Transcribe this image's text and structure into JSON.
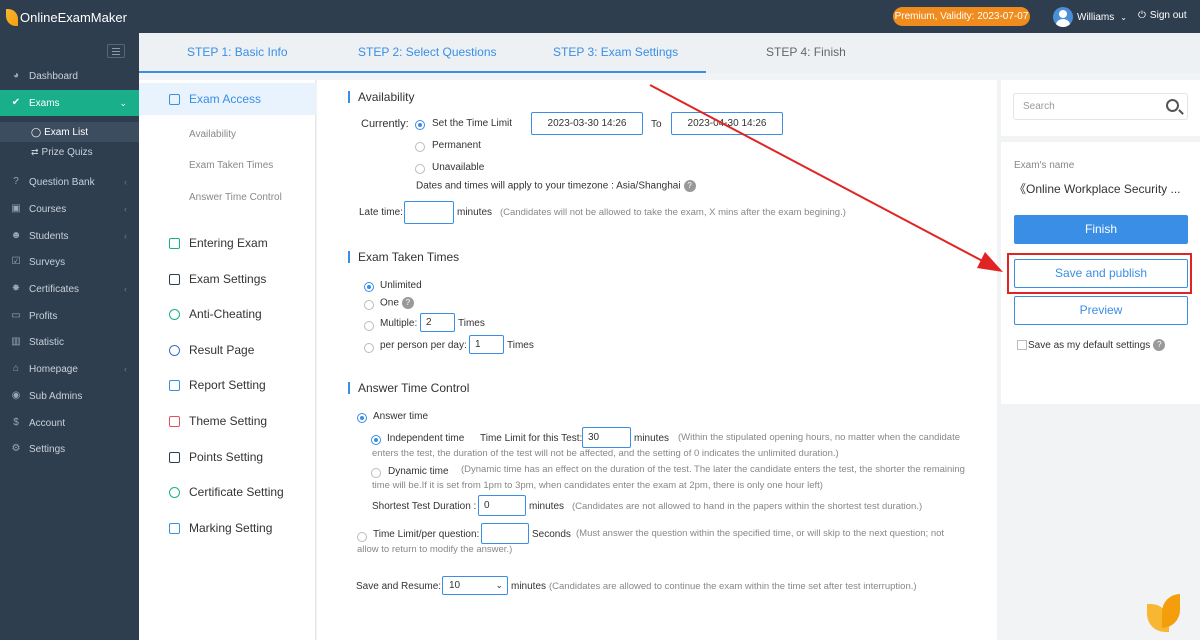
{
  "app": {
    "name": "OnlineExamMaker"
  },
  "header": {
    "premium": "Premium, Validity: 2023-07-07",
    "user": "Williams",
    "signout": "Sign out"
  },
  "sidebar": {
    "items": [
      {
        "label": "Dashboard",
        "icon": "dashboard-icon"
      },
      {
        "label": "Exams",
        "icon": "check-circle-icon"
      },
      {
        "label": "Question Bank",
        "icon": "question-icon"
      },
      {
        "label": "Courses",
        "icon": "courses-icon"
      },
      {
        "label": "Students",
        "icon": "students-icon"
      },
      {
        "label": "Surveys",
        "icon": "surveys-icon"
      },
      {
        "label": "Certificates",
        "icon": "certificates-icon"
      },
      {
        "label": "Profits",
        "icon": "profits-icon"
      },
      {
        "label": "Statistic",
        "icon": "statistic-icon"
      },
      {
        "label": "Homepage",
        "icon": "homepage-icon"
      },
      {
        "label": "Sub Admins",
        "icon": "sub-admins-icon"
      },
      {
        "label": "Account",
        "icon": "account-icon"
      },
      {
        "label": "Settings",
        "icon": "settings-icon"
      }
    ],
    "exam_sub": [
      {
        "label": "Exam List",
        "icon": "check-circle-icon"
      },
      {
        "label": "Prize Quizs",
        "icon": "shuffle-icon"
      }
    ]
  },
  "steps": [
    "STEP 1: Basic Info",
    "STEP 2: Select Questions",
    "STEP 3: Exam Settings",
    "STEP 4: Finish"
  ],
  "left_menu": {
    "exam_access": "Exam Access",
    "subs": [
      "Availability",
      "Exam Taken Times",
      "Answer Time Control"
    ],
    "items": [
      "Entering Exam",
      "Exam Settings",
      "Anti-Cheating",
      "Result Page",
      "Report Setting",
      "Theme Setting",
      "Points Setting",
      "Certificate Setting",
      "Marking Setting"
    ]
  },
  "availability": {
    "title": "Availability",
    "currently": "Currently:",
    "set_time_limit": "Set the Time Limit",
    "start": "2023-03-30 14:26",
    "to": "To",
    "end": "2023-04-30 14:26",
    "permanent": "Permanent",
    "unavailable": "Unavailable",
    "timezone": "Dates and times will apply to your timezone : Asia/Shanghai",
    "late_time": "Late time:",
    "minutes": "minutes",
    "late_note": "(Candidates will not be allowed to take the exam, X mins after the exam begining.)"
  },
  "taken": {
    "title": "Exam Taken Times",
    "unlimited": "Unlimited",
    "one": "One",
    "multiple": "Multiple:",
    "multiple_value": "2",
    "times": "Times",
    "per_day": "per person per day:",
    "per_day_value": "1"
  },
  "answer": {
    "title": "Answer Time Control",
    "answer_time": "Answer time",
    "independent": "Independent time",
    "limit_label": "Time Limit for this Test:",
    "limit_value": "30",
    "minutes": "minutes",
    "independent_note": "(Within the stipulated opening hours, no matter when the candidate enters the test, the duration of the test will not be affected, and the setting of 0 indicates the unlimited duration.)",
    "dynamic": "Dynamic time",
    "dynamic_note": "(Dynamic time has an effect on the duration of the test. The later the candidate enters the test, the shorter the remaining time will be.If it is set from 1pm to 3pm, when candidates enter the exam at 2pm, there is only one hour left)",
    "shortest_label": "Shortest Test Duration :",
    "shortest_value": "0",
    "shortest_note": "(Candidates are not allowed to hand in the papers within the shortest test duration.)",
    "per_question": "Time Limit/per question:",
    "seconds": "Seconds",
    "per_question_note": "(Must answer the question within the specified time, or will skip to the next question; not allow to return to modify the answer.)",
    "resume_label": "Save and Resume:",
    "resume_value": "10",
    "resume_note": "(Candidates are allowed to continue the exam within the time set after test interruption.)"
  },
  "right": {
    "search_placeholder": "Search",
    "exam_name_label": "Exam's name",
    "exam_name": "《Online Workplace Security ...",
    "finish": "Finish",
    "save_publish": "Save and publish",
    "preview": "Preview",
    "default_settings": "Save as my default settings"
  },
  "colors": {
    "accent": "#3a8ee6",
    "sidebar": "#2f3e4e",
    "active": "#1aaf8b",
    "premium": "#f08c1e",
    "highlight": "#e02424"
  }
}
